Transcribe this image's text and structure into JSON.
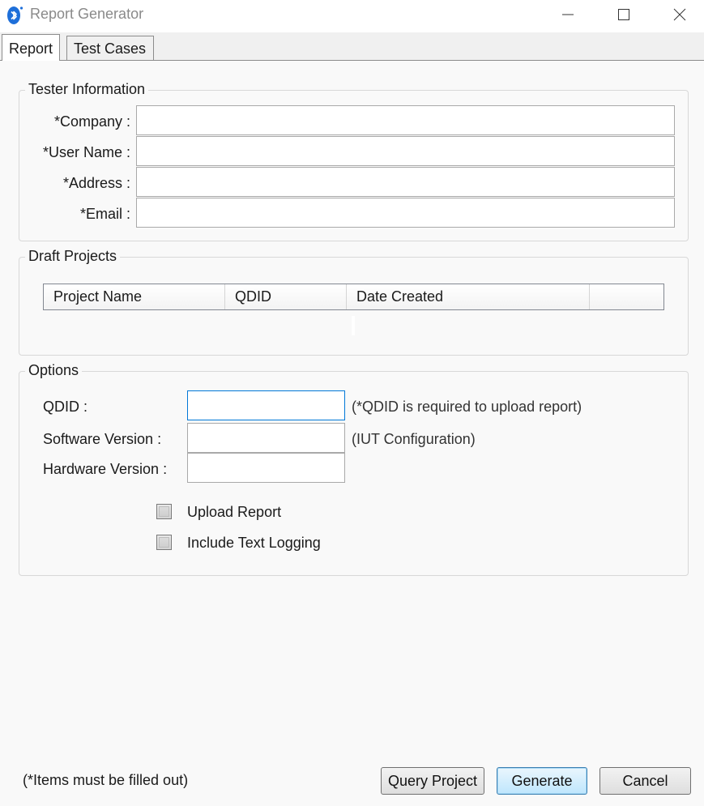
{
  "window": {
    "title": "Report Generator"
  },
  "tabs": [
    {
      "label": "Report"
    },
    {
      "label": "Test Cases"
    }
  ],
  "tester_info": {
    "legend": "Tester Information",
    "fields": [
      {
        "label": "*Company :",
        "value": ""
      },
      {
        "label": "*User Name :",
        "value": ""
      },
      {
        "label": "*Address :",
        "value": ""
      },
      {
        "label": "*Email :",
        "value": ""
      }
    ]
  },
  "draft_projects": {
    "legend": "Draft Projects",
    "columns": [
      "Project Name",
      "QDID",
      "Date Created",
      ""
    ]
  },
  "options": {
    "legend": "Options",
    "qdid": {
      "label": "QDID :",
      "value": "",
      "hint": "(*QDID is required to upload report)"
    },
    "software_version": {
      "label": "Software Version :",
      "value": "",
      "hint": "(IUT Configuration)"
    },
    "hardware_version": {
      "label": "Hardware Version :",
      "value": ""
    },
    "upload_report": {
      "label": "Upload Report",
      "checked": false
    },
    "include_text_logging": {
      "label": "Include Text Logging",
      "checked": false
    }
  },
  "footer": {
    "note": "(*Items must be filled out)",
    "query_label": "Query Project",
    "generate_label": "Generate",
    "cancel_label": "Cancel"
  },
  "colors": {
    "accent": "#0078d7",
    "focus_border": "#0078d7"
  }
}
